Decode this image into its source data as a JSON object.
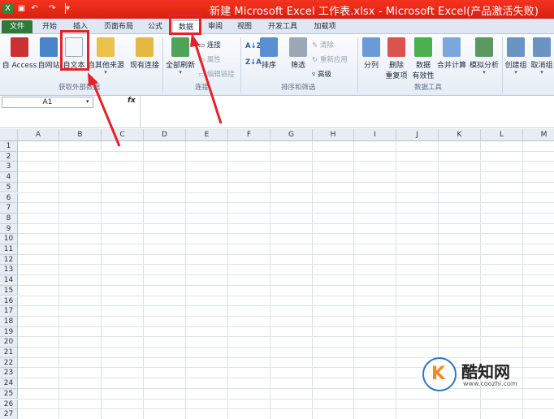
{
  "window": {
    "title": "新建 Microsoft Excel 工作表.xlsx - Microsoft Excel(产品激活失败)"
  },
  "tabs": [
    "文件",
    "开始",
    "插入",
    "页面布局",
    "公式",
    "数据",
    "审阅",
    "视图",
    "开发工具",
    "加载项"
  ],
  "ribbon": {
    "access": "自 Access",
    "web": "自网站",
    "text": "自文本",
    "other": "自其他来源",
    "existing": "现有连接",
    "refresh_all": "全部刷新",
    "connections": "连接",
    "properties": "属性",
    "edit_links": "编辑链接",
    "sort": "排序",
    "filter": "筛选",
    "clear": "清除",
    "reapply": "重新应用",
    "advanced": "高级",
    "split": "分列",
    "remove_dup_1": "删除",
    "remove_dup_2": "重复项",
    "validation_1": "数据",
    "validation_2": "有效性",
    "consolidate": "合并计算",
    "whatif": "模拟分析",
    "group": "创建组",
    "ungroup": "取消组",
    "group_get_external": "获取外部数据",
    "group_connections": "连接",
    "group_sort_filter": "排序和筛选",
    "group_data_tools": "数据工具"
  },
  "formula_bar": {
    "cell": "A1",
    "fx": "fx",
    "value": ""
  },
  "grid": {
    "columns": [
      "A",
      "B",
      "C",
      "D",
      "E",
      "F",
      "G",
      "H",
      "I",
      "J",
      "K",
      "L",
      "M"
    ],
    "rows": [
      "1",
      "2",
      "3",
      "4",
      "5",
      "6",
      "7",
      "8",
      "9",
      "10",
      "11",
      "12",
      "13",
      "14",
      "15",
      "16",
      "17",
      "18",
      "19",
      "20",
      "21",
      "22",
      "23",
      "24",
      "25",
      "26",
      "27"
    ]
  },
  "watermark": {
    "brand": "酷知网",
    "url": "www.coozhi.com"
  },
  "colors": {
    "title_bar": "#e2231a",
    "highlight": "#e2232a",
    "file_tab": "#2f7a3a"
  }
}
